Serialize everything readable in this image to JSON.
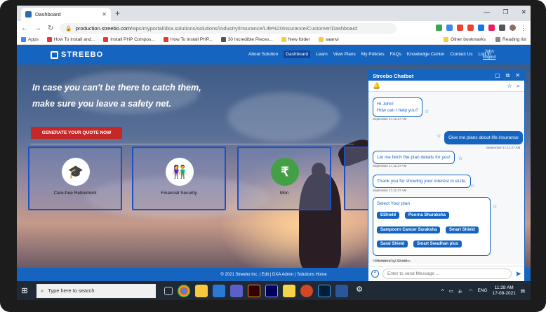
{
  "browser": {
    "tab_title": "Dashboard",
    "url_domain": "production.streebo.com",
    "url_path": "/wps/myportal/dxa.solutions/solutions/Industry/Insurance/Life%20Insurance/Customer/Dashboard",
    "bookmarks": [
      "Apps",
      "How To Install and...",
      "Install PHP Compos...",
      "How To Install PHP...",
      "30 Incredible Pieces...",
      "New folder",
      "saanvi"
    ],
    "bookmarks_right": [
      "Other bookmarks",
      "Reading list"
    ]
  },
  "site": {
    "logo": "STREEBO",
    "menu": [
      "About Solution",
      "Dashboard",
      "Learn",
      "View Plans",
      "My Policies",
      "FAQs",
      "Knowledge Center",
      "Contact Us",
      "Log In"
    ],
    "user_name": "John",
    "logout": "Logout",
    "hero_line1": "In case you can't be there to catch them,",
    "hero_line2": "make sure you leave a safety net.",
    "cta": "GENERATE YOUR QUOTE NOW",
    "cards": [
      "Care-free Retirement",
      "Financial Security",
      "Mon"
    ],
    "footer": "© 2021 Streebo Inc. | Edit | DXA Admin | Solutions Home"
  },
  "chat": {
    "title": "Streebo Chatbot",
    "greeting_line1": "Hi John!",
    "greeting_line2": "How can I help you?",
    "ts1": "September 17,11:27 AM",
    "user_msg": "Give me plans about life insurance",
    "ts2": "September 17,11:27 AM",
    "fetch": "Let me fetch the plan details for you!",
    "ts3": "September 17,11:27 AM",
    "thanks": "Thank you for showing your interest in eLife.",
    "ts4": "September 17,11:27 AM",
    "select": "Select Your plan",
    "plans": [
      "EShield",
      "Poorna Shuraksha",
      "Sampoorn Cancer Suraksha",
      "Smart Shield",
      "Saral Shield",
      "Smart Swadhan plus"
    ],
    "ts5": "September 17,11:27 AM",
    "powered": "Powered by Streebo",
    "input_placeholder": "Enter to send Message ..."
  },
  "taskbar": {
    "search": "Type here to search",
    "lang": "ENG",
    "time": "11:28 AM",
    "date": "17-09-2021"
  }
}
